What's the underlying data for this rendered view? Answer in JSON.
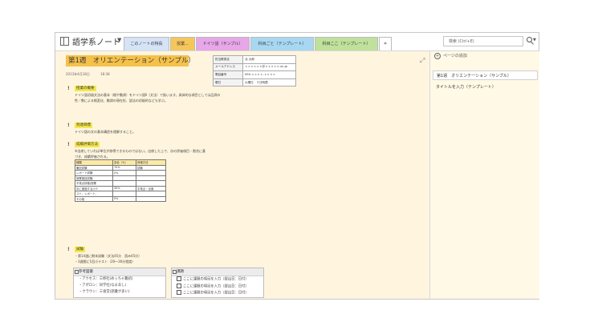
{
  "notebook": {
    "title": "語学系ノート"
  },
  "tabs": [
    {
      "label": "このノートの特長",
      "color": "#d5e3f7"
    },
    {
      "label": "授業...",
      "color": "#f5c65a"
    },
    {
      "label": "ドイツ語（サンプル）",
      "color": "#e7a7e8"
    },
    {
      "label": "科目ごと（テンプレート）",
      "color": "#a8d7f2"
    },
    {
      "label": "科目ここ（テンプレート）",
      "color": "#bfe19c"
    },
    {
      "label": "＊",
      "color": "#ffffff"
    }
  ],
  "search": {
    "placeholder": "検索 (Ctrl+E)"
  },
  "page": {
    "title": "第1週　オリエンテーション（サンプル）",
    "date": "2013年4月18日",
    "time": "18:38",
    "info": [
      {
        "k": "担当教員名",
        "v": "北 大郎"
      },
      {
        "k": "メールアドレス",
        "v": "ｘｘｘｘｘｘ@ｘｘｘｘｘ.ac.jp"
      },
      {
        "k": "電話番号",
        "v": "090-ｘｘｘｘ-ｘｘｘｘ"
      },
      {
        "k": "曜日",
        "v": "火曜日　３日時限"
      }
    ],
    "sections": [
      {
        "label": "授業の概要",
        "lines": [
          "ドイツ語初級文法の基本（格や動詞）をドイツ語Ⅱ（文法）で扱います。具体的な項目としては品詞の",
          "性／数による格変化、動詞の現在形、語法の初級的なども学ぶ。"
        ]
      },
      {
        "label": "到達目標",
        "lines": [
          "ドイツ語の文の基本構造を理解すること。"
        ]
      },
      {
        "label": "成績評価方法",
        "lines": [
          "※出席していれば単位が修得できるものではない。出席した上で、次の評価項目・割合に基",
          "づき、成績評価される。"
        ]
      },
      {
        "label": "試験",
        "lines": [
          "・第14週に期末試験（文法45分　読み45分）",
          "・3週間に1回小テスト（20～30分程度）"
        ]
      }
    ],
    "eval_table": {
      "header": [
        "種類",
        "割合（%）",
        "評価方法"
      ],
      "rows": [
        [
          "筆記試験",
          "70%",
          "試験"
        ],
        [
          "レポート試験",
          "0%",
          ""
        ],
        [
          "授業実技試験",
          "",
          ""
        ],
        [
          "平常点評価(授業",
          "",
          ""
        ],
        [
          "中に実施する小テ",
          "30%",
          "平常点・出席"
        ],
        [
          "スト、レポート、",
          "",
          ""
        ],
        [
          "その他",
          "0%",
          ""
        ]
      ]
    },
    "refbox": {
      "title": "参考図書",
      "lines": [
        "・アクセス：三修社(めっちゃ難初)",
        "・アポロン：同学社(なまあし)",
        "・クラウン：三省堂(語彙が多い)"
      ]
    },
    "hwbox": {
      "title": "課題",
      "lines": [
        "ここに課題の項目を入力（提出日：日付）",
        "ここに課題の項目を入力（提出日：日付）",
        "ここに課題の項目を入力（提出日：日付）"
      ]
    }
  },
  "sidepanel": {
    "add_page": "ページの追加",
    "pages": [
      {
        "label": "第1週　オリエンテーション（サンプル）",
        "selected": true
      },
      {
        "label": "タイトルを入力（テンプレート）",
        "selected": false
      }
    ]
  }
}
